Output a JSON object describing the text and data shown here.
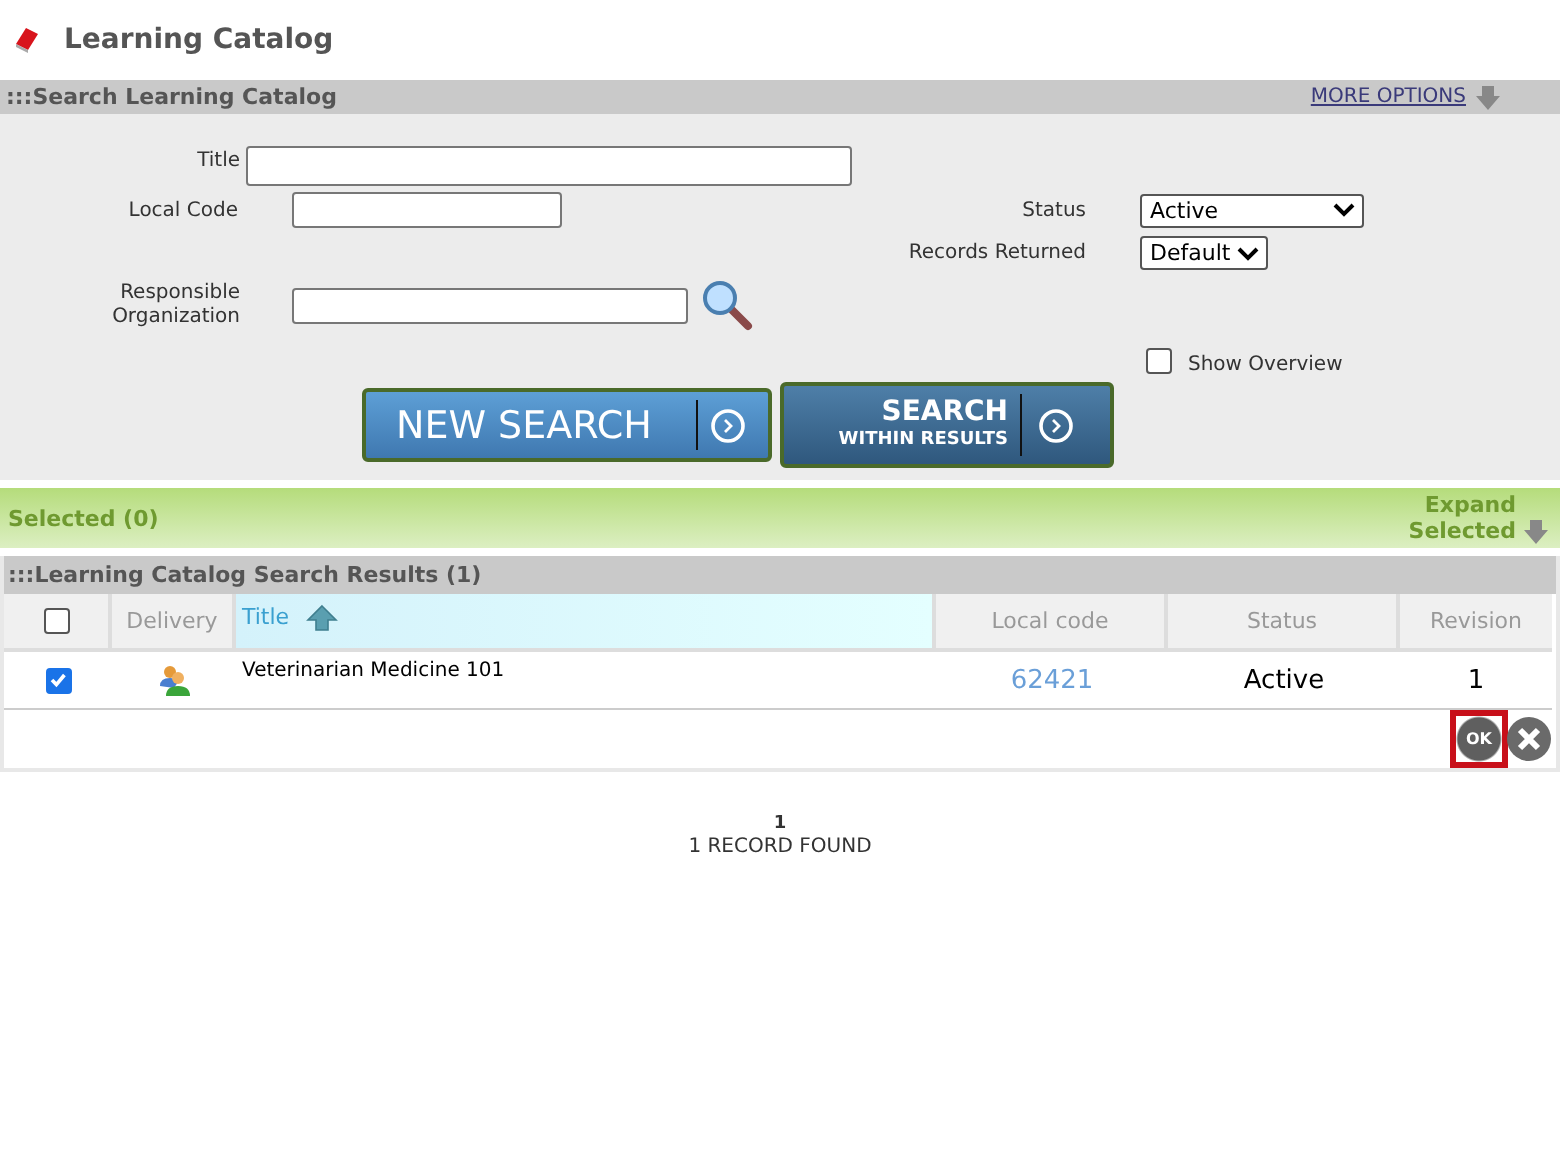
{
  "page_title": "Learning Catalog",
  "search": {
    "title": ":::Search Learning Catalog",
    "more_options": "MORE OPTIONS",
    "title_label": "Title",
    "local_code_label": "Local Code",
    "org_label": "Responsible Organization",
    "status": {
      "label": "Status",
      "value": "Active"
    },
    "records_returned": {
      "label": "Records Returned",
      "value": "Default"
    },
    "show_overview": {
      "label": "Show Overview",
      "checked": false
    },
    "new_search": "NEW SEARCH",
    "search_within": {
      "line1": "SEARCH",
      "line2": "WITHIN RESULTS"
    }
  },
  "selected_bar": {
    "label": "Selected (0)",
    "expand": "Expand Selected"
  },
  "results": {
    "title": ":::Learning Catalog Search Results (1)",
    "select_all": {
      "checked": false
    },
    "columns": [
      {
        "label": "Delivery",
        "sorted": false
      },
      {
        "label": "Title",
        "sorted": true
      },
      {
        "label": "Local code",
        "sorted": false
      },
      {
        "label": "Status",
        "sorted": false
      },
      {
        "label": "Revision",
        "sorted": false
      }
    ],
    "rows": [
      {
        "selected": true,
        "title": "Veterinarian Medicine 101",
        "local_code": "62421",
        "status": "Active",
        "revision": "1"
      }
    ],
    "ok": {
      "label": "OK",
      "highlighted": true
    }
  },
  "pager": {
    "page": "1",
    "summary": "1 RECORD FOUND"
  }
}
